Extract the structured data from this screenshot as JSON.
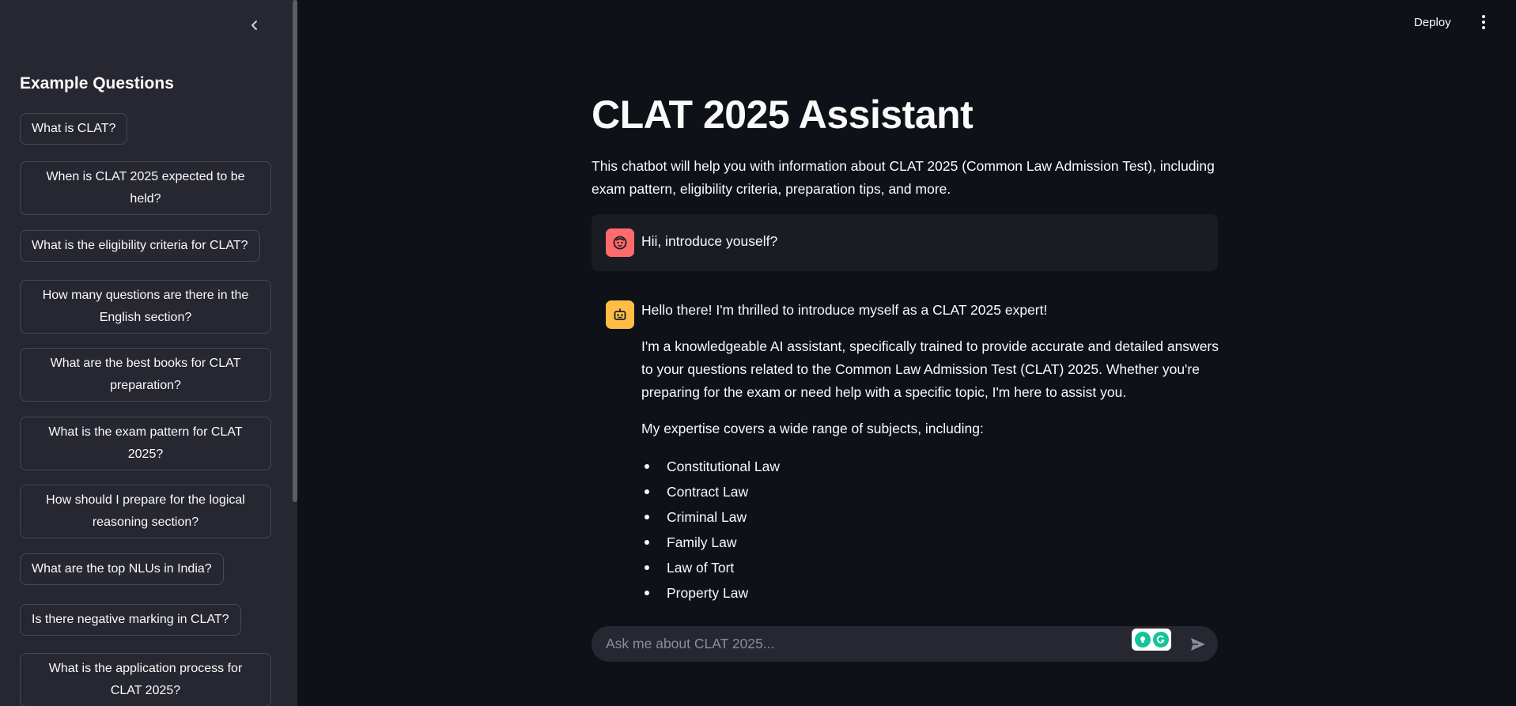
{
  "sidebar": {
    "heading": "Example Questions",
    "questions": [
      "What is CLAT?",
      "When is CLAT 2025 expected to be held?",
      "What is the eligibility criteria for CLAT?",
      "How many questions are there in the English section?",
      "What are the best books for CLAT preparation?",
      "What is the exam pattern for CLAT 2025?",
      "How should I prepare for the logical reasoning section?",
      "What are the top NLUs in India?",
      "Is there negative marking in CLAT?",
      "What is the application process for CLAT 2025?"
    ]
  },
  "header": {
    "deploy_label": "Deploy"
  },
  "main": {
    "title": "CLAT 2025 Assistant",
    "intro": "This chatbot will help you with information about CLAT 2025 (Common Law Admission Test), including exam pattern, eligibility criteria, preparation tips, and more.",
    "messages": [
      {
        "role": "user",
        "text": "Hii, introduce youself?"
      },
      {
        "role": "assistant",
        "paragraphs": [
          "Hello there! I'm thrilled to introduce myself as a CLAT 2025 expert!",
          "I'm a knowledgeable AI assistant, specifically trained to provide accurate and detailed answers to your questions related to the Common Law Admission Test (CLAT) 2025. Whether you're preparing for the exam or need help with a specific topic, I'm here to assist you.",
          "My expertise covers a wide range of subjects, including:"
        ],
        "list": [
          "Constitutional Law",
          "Contract Law",
          "Criminal Law",
          "Family Law",
          "Law of Tort",
          "Property Law"
        ]
      }
    ]
  },
  "chat_input": {
    "placeholder": "Ask me about CLAT 2025...",
    "value": ""
  },
  "colors": {
    "background": "#0e1117",
    "sidebar": "#262730",
    "user_avatar": "#ff6b6b",
    "bot_avatar": "#ffbd45",
    "text": "#fafafa"
  }
}
